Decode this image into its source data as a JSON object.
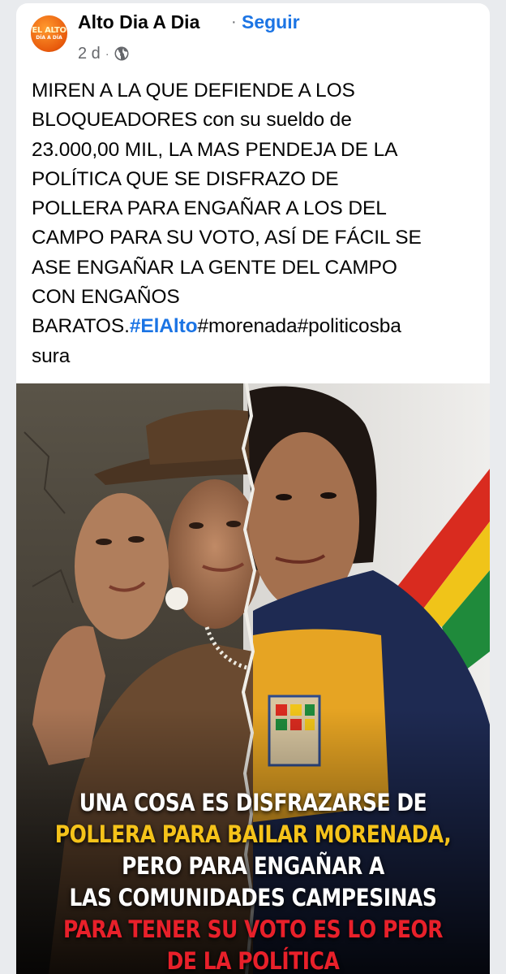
{
  "post": {
    "author": "Alto Dia A Dia",
    "separator": "·",
    "follow_label": "Seguir",
    "time": "2 d",
    "time_separator": "·",
    "privacy_icon": "globe-icon",
    "avatar_text_1": "EL ALTO",
    "avatar_text_2": "DÍA A DÍA",
    "text_plain": "MIREN A LA QUE DEFIENDE A LOS\nBLOQUEADORES con su sueldo de\n23.000,00 MIL, LA MAS PENDEJA DE LA\nPOLÍTICA QUE SE DISFRAZO DE\nPOLLERA PARA ENGAÑAR A LOS DEL\nCAMPO PARA SU VOTO, ASÍ DE FÁCIL SE\nASE ENGAÑAR LA GENTE DEL CAMPO\nCON ENGAÑOS\nBARATOS.",
    "hashtag_1": "#ElAlto",
    "hashtag_2": "#morenada",
    "hashtag_3": "#politicosba",
    "hashtag_3_cont": "sura"
  },
  "image": {
    "line1_a": "UNA COSA ES DISFRAZARSE ",
    "line1_b": "DE",
    "line2": "POLLERA PARA BAILAR MORENADA,",
    "line3": "PERO PARA ENGAÑAR A",
    "line4": "LAS COMUNIDADES CAMPESINAS",
    "line5": "PARA TENER SU VOTO ES LO PEOR",
    "line6": "DE LA POLÍTICA",
    "colors": {
      "white": "#ffffff",
      "yellow": "#f5c31a",
      "red": "#e8202a"
    }
  },
  "colors": {
    "link": "#1b74e4",
    "text": "#050505",
    "meta": "#65676b"
  }
}
